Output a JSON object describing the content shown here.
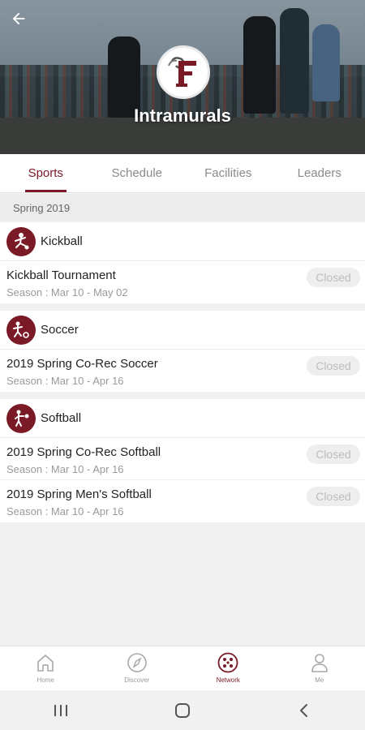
{
  "header": {
    "title": "Intramurals",
    "logo_letter": "F"
  },
  "tabs": [
    {
      "label": "Sports",
      "active": true
    },
    {
      "label": "Schedule",
      "active": false
    },
    {
      "label": "Facilities",
      "active": false
    },
    {
      "label": "Leaders",
      "active": false
    }
  ],
  "season_label": "Spring 2019",
  "groups": [
    {
      "title": "Kickball",
      "icon": "kickball-icon",
      "events": [
        {
          "name": "Kickball Tournament",
          "season": "Season : Mar 10 - May 02",
          "status": "Closed"
        }
      ]
    },
    {
      "title": "Soccer",
      "icon": "soccer-icon",
      "events": [
        {
          "name": "2019 Spring Co-Rec Soccer",
          "season": "Season : Mar 10 - Apr 16",
          "status": "Closed"
        }
      ]
    },
    {
      "title": "Softball",
      "icon": "softball-icon",
      "events": [
        {
          "name": "2019 Spring Co-Rec Softball",
          "season": "Season : Mar 10 - Apr 16",
          "status": "Closed"
        },
        {
          "name": "2019 Spring Men's Softball",
          "season": "Season : Mar 10 - Apr 16",
          "status": "Closed"
        }
      ]
    }
  ],
  "bottom_nav": [
    {
      "label": "Home",
      "icon": "home-icon",
      "active": false
    },
    {
      "label": "Discover",
      "icon": "compass-icon",
      "active": false
    },
    {
      "label": "Network",
      "icon": "network-icon",
      "active": true
    },
    {
      "label": "Me",
      "icon": "person-icon",
      "active": false
    }
  ],
  "colors": {
    "accent": "#7a1a26",
    "badge_bg": "#eeeeee",
    "badge_text": "#bdbdbd"
  }
}
